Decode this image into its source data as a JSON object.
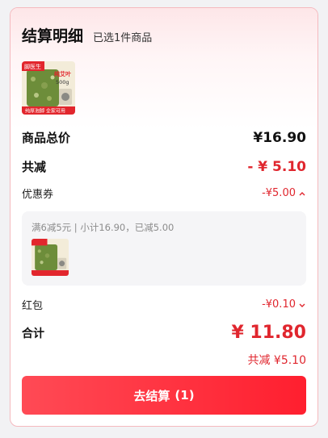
{
  "header": {
    "title": "结算明细",
    "subtitle": "已选1件商品"
  },
  "product": {
    "brand": "脚医生",
    "name": "纯艾叶",
    "weight": "500g",
    "tags": "纯厚泡脚 全家可用"
  },
  "summary": {
    "goods_total_label": "商品总价",
    "goods_total_value": "¥16.90",
    "discount_label": "共减",
    "discount_value": "- ¥ 5.10",
    "coupon_label": "优惠券",
    "coupon_value": "-¥5.00",
    "coupon_detail": "满6减5元 | 小计16.90，已减5.00",
    "redpacket_label": "红包",
    "redpacket_value": "-¥0.10",
    "total_label": "合计",
    "total_value": "¥ 11.80",
    "saved_text": "共减 ¥5.10"
  },
  "checkout": {
    "label": "去结算",
    "count": "(1)"
  },
  "colors": {
    "accent": "#e0262e",
    "button": "#ff2a38"
  }
}
